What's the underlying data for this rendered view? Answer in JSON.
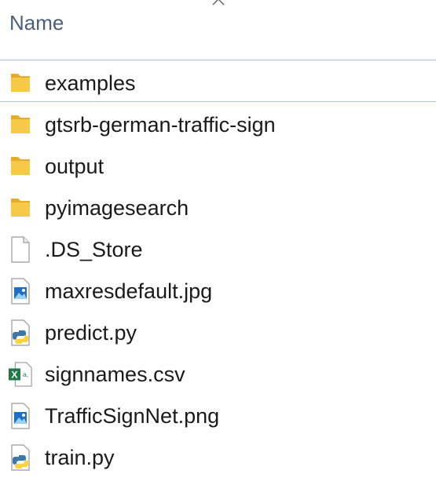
{
  "header": {
    "name_label": "Name"
  },
  "files": [
    {
      "name": "examples",
      "icon": "folder-icon"
    },
    {
      "name": "gtsrb-german-traffic-sign",
      "icon": "folder-icon"
    },
    {
      "name": "output",
      "icon": "folder-icon"
    },
    {
      "name": "pyimagesearch",
      "icon": "folder-icon"
    },
    {
      "name": ".DS_Store",
      "icon": "file-icon"
    },
    {
      "name": "maxresdefault.jpg",
      "icon": "image-file-icon"
    },
    {
      "name": "predict.py",
      "icon": "python-file-icon"
    },
    {
      "name": "signnames.csv",
      "icon": "excel-csv-icon"
    },
    {
      "name": "TrafficSignNet.png",
      "icon": "image-file-icon"
    },
    {
      "name": "train.py",
      "icon": "python-file-icon"
    }
  ],
  "colors": {
    "folder": "#f7c948",
    "folder_dark": "#e8aa2c",
    "selection_line": "#a9c3de",
    "header_text": "#4c607a"
  }
}
